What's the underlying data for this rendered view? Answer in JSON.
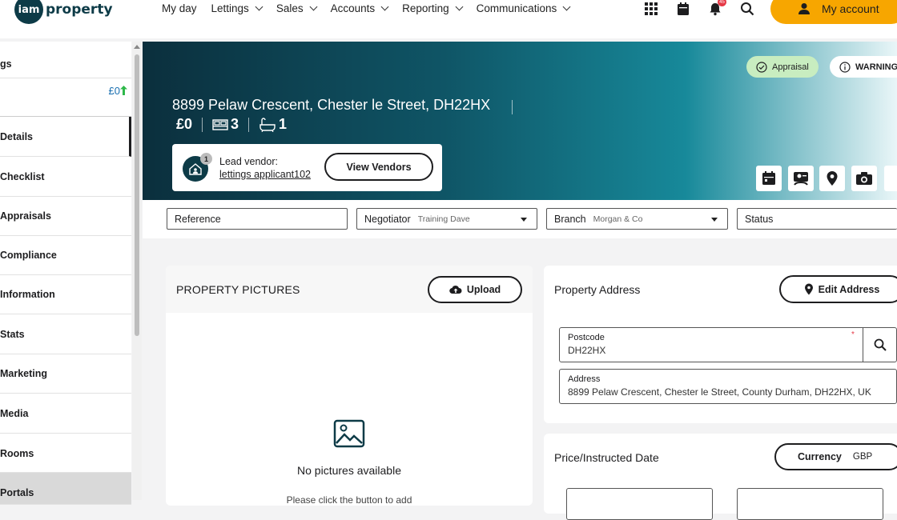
{
  "brand": {
    "logo_mark": "iam",
    "logo_text": "property"
  },
  "nav": {
    "items": [
      "My day",
      "Lettings",
      "Sales",
      "Accounts",
      "Reporting",
      "Communications"
    ],
    "notification_count": "45",
    "account_label": "My account"
  },
  "sidebar": {
    "header": "gs",
    "price": "£0",
    "items": [
      "Details",
      "Checklist",
      "Appraisals",
      "Compliance",
      "Information",
      "Stats",
      "Marketing",
      "Media",
      "Rooms",
      "Portals"
    ],
    "active": "Details"
  },
  "hero": {
    "address": "8899 Pelaw Crescent, Chester le Street, DH22HX",
    "price": "£0",
    "bedrooms": "3",
    "bathrooms": "1",
    "vendor_count": "1",
    "lead_vendor_label": "Lead vendor:",
    "lead_vendor_name": "lettings applicant102",
    "view_vendors_label": "View Vendors",
    "status_pills": [
      "Appraisal",
      "WARNING"
    ]
  },
  "filters": {
    "reference_label": "Reference",
    "negotiator_label": "Negotiator",
    "negotiator_value": "Training Dave",
    "branch_label": "Branch",
    "branch_value": "Morgan & Co",
    "status_label": "Status"
  },
  "pictures": {
    "title": "PROPERTY PICTURES",
    "upload_label": "Upload",
    "empty_title": "No pictures available",
    "empty_hint": "Please click the button to add"
  },
  "address_card": {
    "title": "Property Address",
    "edit_label": "Edit Address",
    "postcode_label": "Postcode",
    "postcode_value": "DH22HX",
    "required_mark": "*",
    "address_label": "Address",
    "address_value": "8899 Pelaw Crescent, Chester le Street, County Durham, DH22HX, UK"
  },
  "price_card": {
    "title": "Price/Instructed Date",
    "currency_label": "Currency",
    "currency_value": "GBP"
  },
  "colors": {
    "accent": "#f7a600",
    "dark": "#0d3b47",
    "teal": "#17899a",
    "appraisal_pill": "#c8edc0"
  }
}
